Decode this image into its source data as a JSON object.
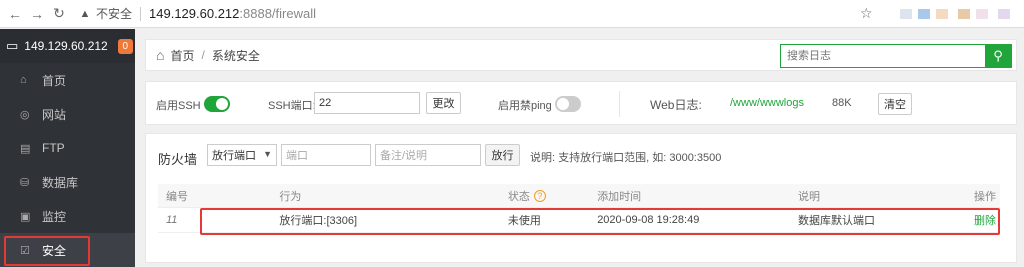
{
  "browser": {
    "insecure_label": "不安全",
    "url_host": "149.129.60.212",
    "url_path": ":8888/firewall"
  },
  "sidebar": {
    "host": "149.129.60.212",
    "badge": "0",
    "items": [
      {
        "label": "首页",
        "icon": "home-icon"
      },
      {
        "label": "网站",
        "icon": "globe-icon"
      },
      {
        "label": "FTP",
        "icon": "ftp-icon"
      },
      {
        "label": "数据库",
        "icon": "database-icon"
      },
      {
        "label": "监控",
        "icon": "monitor-icon"
      },
      {
        "label": "安全",
        "icon": "shield-icon"
      }
    ]
  },
  "breadcrumb": {
    "home": "首页",
    "sep": "/",
    "current": "系统安全"
  },
  "search": {
    "placeholder": "搜索日志"
  },
  "settings": {
    "ssh_label": "启用SSH",
    "ssh_enabled": true,
    "ssh_port_label": "SSH端口:",
    "ssh_port_value": "22",
    "change_button": "更改",
    "ping_label": "启用禁ping",
    "ping_enabled": false,
    "weblog_label": "Web日志:",
    "weblog_path": "/www/wwwlogs",
    "weblog_size": "88K",
    "clear_button": "清空"
  },
  "firewall": {
    "title": "防火墙",
    "rule_select": "放行端口",
    "port_placeholder": "端口",
    "note_placeholder": "备注/说明",
    "allow_button": "放行",
    "hint": "说明: 支持放行端口范围, 如: 3000:3500"
  },
  "table": {
    "headers": [
      "编号",
      "行为",
      "状态",
      "添加时间",
      "说明",
      "操作"
    ],
    "rows": [
      {
        "id": "11",
        "action": "放行端口:[3306]",
        "status": "未使用",
        "time": "2020-09-08 19:28:49",
        "note": "数据库默认端口",
        "op": "删除"
      }
    ]
  },
  "colors": {
    "accent": "#20a53a",
    "highlight": "#e53935",
    "sidebar_bg": "#2f3237",
    "badge": "#f0793a"
  }
}
